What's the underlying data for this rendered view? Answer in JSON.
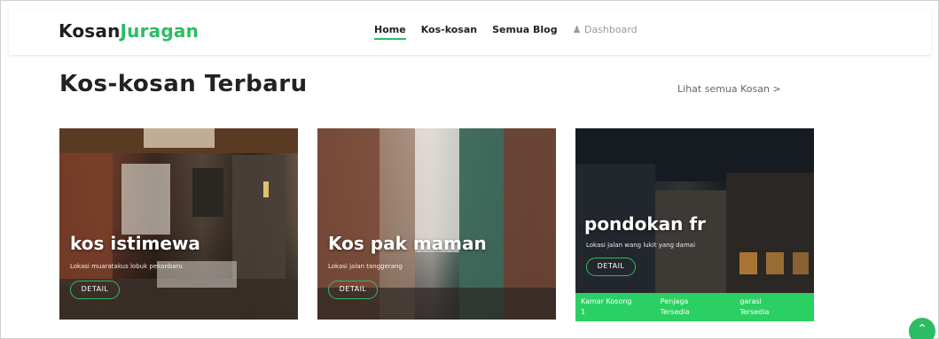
{
  "brand": {
    "part1": "Kosan",
    "part2": "Juragan",
    "accent_color": "#2bbd63"
  },
  "nav": {
    "items": [
      {
        "label": "Home",
        "active": true
      },
      {
        "label": "Kos-kosan",
        "active": false
      },
      {
        "label": "Semua Blog",
        "active": false
      }
    ],
    "dashboard": {
      "icon": "user-icon",
      "label": "Dashboard"
    }
  },
  "section": {
    "title": "Kos-kosan Terbaru",
    "see_all": "Lihat semua Kosan >"
  },
  "cards": [
    {
      "title": "kos istimewa",
      "subtitle": "Lokasi muaratakus lobuk pekanbaru",
      "button": "DETAIL"
    },
    {
      "title": "Kos pak maman",
      "subtitle": "Lokasi jalan tanggerang",
      "button": "DETAIL"
    },
    {
      "title": "pondokan fr",
      "subtitle": "Lokasi jalan wang lukit yang damai",
      "button": "DETAIL",
      "footer": [
        {
          "label": "Kamar Kosong",
          "value": "1"
        },
        {
          "label": "Penjaga",
          "value": "Tersedia"
        },
        {
          "label": "garasi",
          "value": "Tersedia"
        }
      ]
    }
  ],
  "scroll_top_icon": "chevron-up-icon"
}
